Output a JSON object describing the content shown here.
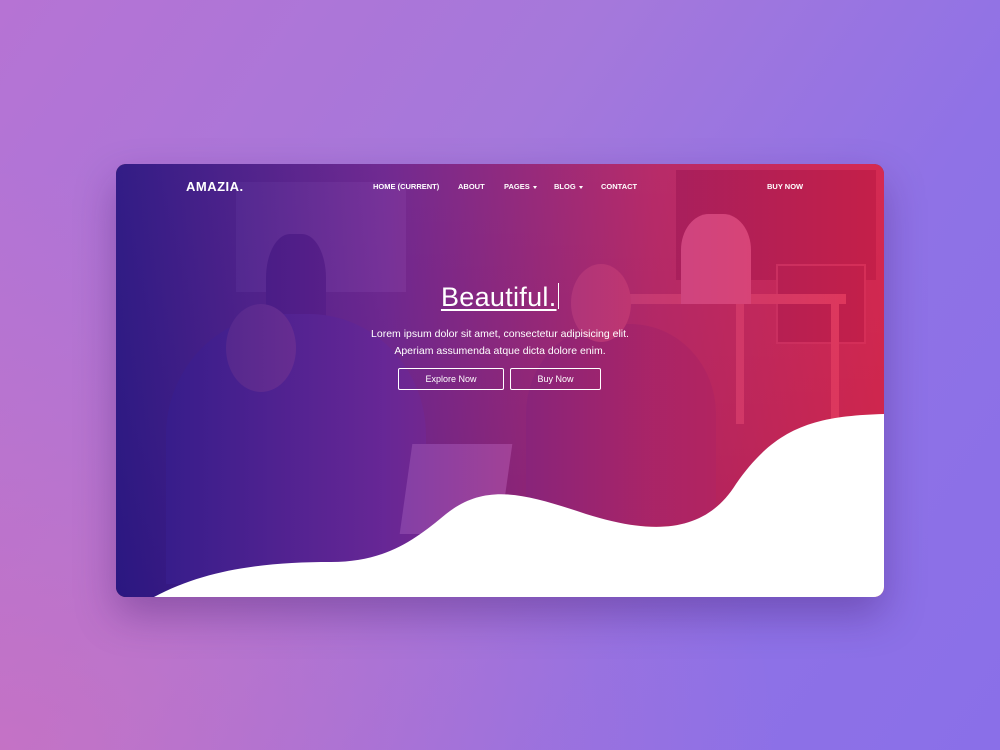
{
  "brand": {
    "logo": "AMAZIA."
  },
  "nav": {
    "home": "HOME (CURRENT)",
    "about": "ABOUT",
    "pages": "PAGES",
    "blog": "BLOG",
    "contact": "CONTACT",
    "buy_now": "BUY NOW"
  },
  "hero": {
    "title": "Beautiful.",
    "text_line1": "Lorem ipsum dolor sit amet, consectetur adipisicing elit.",
    "text_line2": "Aperiam assumenda atque dicta dolore enim.",
    "explore_label": "Explore Now",
    "buy_label": "Buy Now"
  },
  "icons": {
    "pages_dropdown": "chevron-down-icon",
    "blog_dropdown": "chevron-down-icon"
  },
  "colors": {
    "gradient_start": "#281488",
    "gradient_mid": "#6e1ea0",
    "gradient_end": "#eb1e50",
    "background": "#a578db",
    "wave": "#ffffff"
  }
}
